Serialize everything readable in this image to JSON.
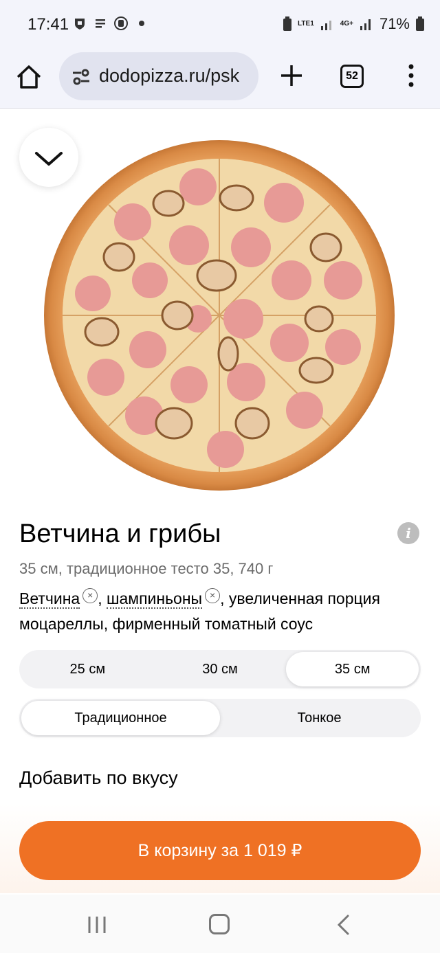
{
  "status_bar": {
    "time": "17:41",
    "battery": "71%",
    "network_a": "LTE1",
    "network_b": "4G+"
  },
  "browser": {
    "url": "dodopizza.ru/psk",
    "tab_count": "52",
    "icons": [
      "home-icon",
      "site-settings-icon",
      "plus-icon",
      "tabs-icon",
      "more-vert-icon"
    ]
  },
  "product": {
    "name": "Ветчина и грибы",
    "subtitle": "35 см, традиционное тесто 35, 740 г",
    "ingredient_1": "Ветчина",
    "separator": ",",
    "ingredient_2": "шампиньоны",
    "ingredients_rest": ", увеличенная порция моцареллы, фирменный томатный соус",
    "sizes": [
      {
        "label": "25 см",
        "selected": false
      },
      {
        "label": "30 см",
        "selected": false
      },
      {
        "label": "35 см",
        "selected": true
      }
    ],
    "doughs": [
      {
        "label": "Традиционное",
        "selected": true
      },
      {
        "label": "Тонкое",
        "selected": false
      }
    ],
    "add_section_title": "Добавить по вкусу",
    "cart_button": "В корзину за 1 019 ₽"
  },
  "colors": {
    "accent": "#ef7124",
    "segment_bg": "#f2f2f4",
    "browser_bg": "#f3f4fb"
  }
}
